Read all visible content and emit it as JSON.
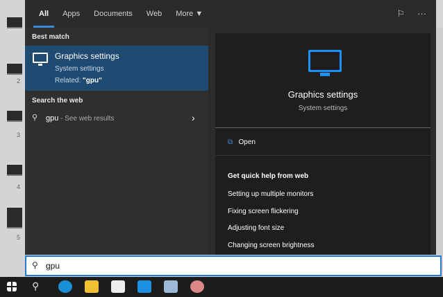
{
  "desktop_strip": {
    "numbers": [
      "2",
      "3",
      "4",
      "5"
    ]
  },
  "tabs": [
    {
      "label": "All",
      "active": true
    },
    {
      "label": "Apps"
    },
    {
      "label": "Documents"
    },
    {
      "label": "Web"
    },
    {
      "label": "More ▼"
    }
  ],
  "top_icons": [
    "feedback-icon",
    "more-options-icon"
  ],
  "left": {
    "best_match_header": "Best match",
    "best_match": {
      "title": "Graphics settings",
      "subtitle": "System settings",
      "related_prefix": "Related: ",
      "related_term": "\"gpu\""
    },
    "web_header": "Search the web",
    "web_result": {
      "query": "gpu",
      "suffix": " - See web results"
    }
  },
  "preview": {
    "title": "Graphics settings",
    "subtitle": "System settings",
    "open_label": "Open",
    "quick_help_header": "Get quick help from web",
    "links": [
      "Setting up multiple monitors",
      "Fixing screen flickering",
      "Adjusting font size",
      "Changing screen brightness"
    ]
  },
  "search": {
    "value": "gpu"
  },
  "taskbar": {
    "items": [
      "start",
      "search",
      "edge",
      "file-explorer",
      "store",
      "mail",
      "remote-desktop",
      "paint"
    ]
  },
  "colors": {
    "accent": "#1e90ff",
    "selected": "#1f4b73"
  }
}
